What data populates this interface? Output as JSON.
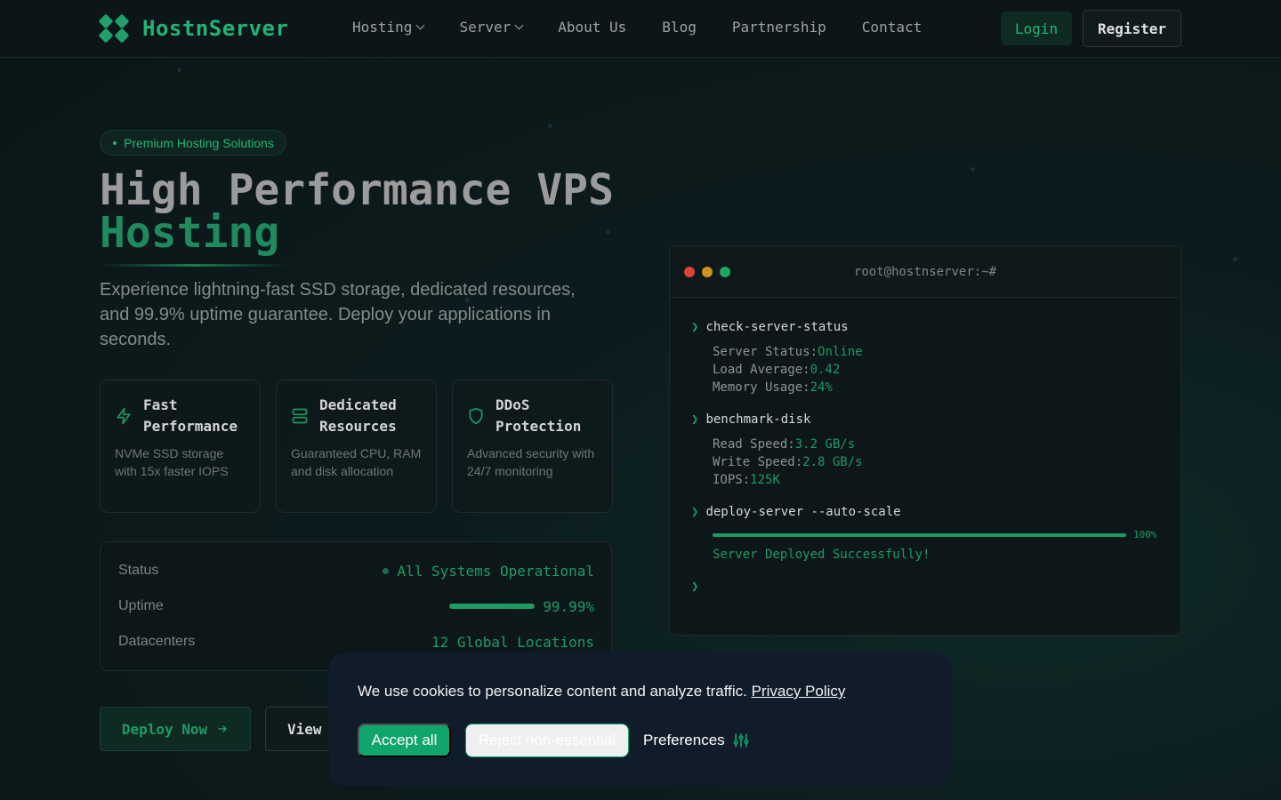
{
  "nav": {
    "brand": "HostnServer",
    "links": [
      {
        "label": "Hosting",
        "dropdown": true
      },
      {
        "label": "Server",
        "dropdown": true
      },
      {
        "label": "About Us",
        "dropdown": false
      },
      {
        "label": "Blog",
        "dropdown": false
      },
      {
        "label": "Partnership",
        "dropdown": false
      },
      {
        "label": "Contact",
        "dropdown": false
      }
    ],
    "login_label": "Login",
    "register_label": "Register"
  },
  "hero": {
    "badge": "Premium Hosting Solutions",
    "title_line1": "High Performance VPS",
    "title_line2": "Hosting",
    "subtitle": "Experience lightning-fast SSD storage, dedicated resources, and 99.9% uptime guarantee. Deploy your applications in seconds."
  },
  "features": [
    {
      "icon": "lightning-icon",
      "title": "Fast Performance",
      "desc": "NVMe SSD storage with 15x faster IOPS"
    },
    {
      "icon": "server-icon",
      "title": "Dedicated Resources",
      "desc": "Guaranteed CPU, RAM and disk allocation"
    },
    {
      "icon": "shield-icon",
      "title": "DDoS Protection",
      "desc": "Advanced security with 24/7 monitoring"
    }
  ],
  "status": {
    "status_label": "Status",
    "status_value": "All Systems Operational",
    "uptime_label": "Uptime",
    "uptime_value": "99.99%",
    "uptime_fraction": 0.9999,
    "datacenters_label": "Datacenters",
    "datacenters_value": "12 Global Locations"
  },
  "cta": {
    "deploy_label": "Deploy Now",
    "view_label": "View"
  },
  "terminal": {
    "title": "root@hostnserver:~#",
    "cmd1": "check-server-status",
    "server_status_key": "Server Status:",
    "server_status_val": "Online",
    "load_key": "Load Average:",
    "load_val": "0.42",
    "memory_key": "Memory Usage:",
    "memory_val": "24%",
    "cmd2": "benchmark-disk",
    "read_key": "Read Speed:",
    "read_val": "3.2 GB/s",
    "write_key": "Write Speed:",
    "write_val": "2.8 GB/s",
    "iops_key": "IOPS:",
    "iops_val": "125K",
    "cmd3": "deploy-server --auto-scale",
    "progress_label": "100%",
    "progress_fraction": 1.0,
    "deploy_msg": "Server Deployed Successfully!"
  },
  "cookie": {
    "text": "We use cookies to personalize content and analyze traffic.",
    "policy_link": "Privacy Policy",
    "accept_label": "Accept all",
    "reject_label": "Reject non-essential",
    "prefs_label": "Preferences"
  },
  "colors": {
    "accent": "#1e9b64",
    "background": "#0c1517",
    "cookie_bg": "#111c2a",
    "dot_red": "#e0443e",
    "dot_yellow": "#d9a520",
    "dot_green": "#1fb56b"
  }
}
